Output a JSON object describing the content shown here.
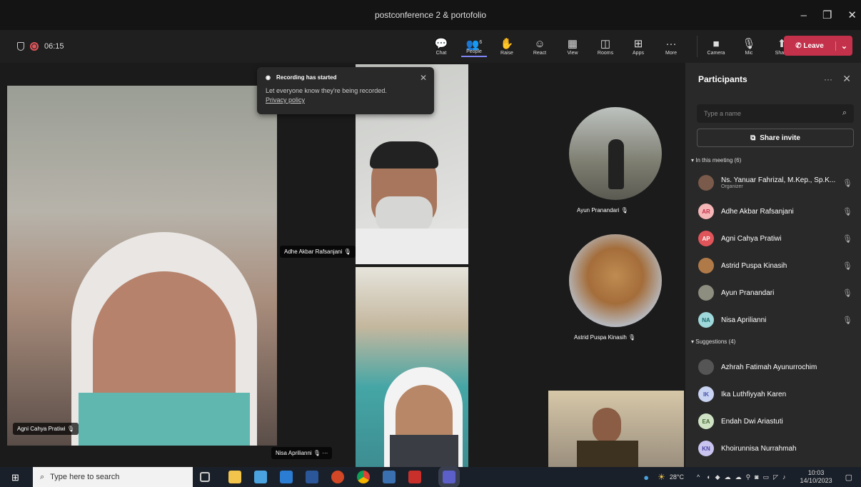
{
  "window": {
    "title": "postconference 2 & portofolio",
    "minimize": "–",
    "maximize": "❐",
    "close": "✕"
  },
  "recording": {
    "timer": "06:15"
  },
  "toolbar": {
    "chat": "Chat",
    "people": "People",
    "people_count": "6",
    "raise": "Raise",
    "react": "React",
    "view": "View",
    "rooms": "Rooms",
    "apps": "Apps",
    "more": "More",
    "camera": "Camera",
    "mic": "Mic",
    "share": "Share",
    "leave": "Leave"
  },
  "toast": {
    "title": "Recording has started",
    "body": "Let everyone know they're being recorded.",
    "link": "Privacy policy"
  },
  "video": {
    "agni": "Agni Cahya Pratiwi",
    "adhe": "Adhe Akbar Rafsanjani",
    "nisa": "Nisa Aprilianni",
    "ayun": "Ayun Pranandari",
    "astrid": "Astrid Puspa Kinasih"
  },
  "panel": {
    "title": "Participants",
    "search_placeholder": "Type a name",
    "share_invite": "Share invite",
    "in_meeting": "In this meeting (6)",
    "suggestions": "Suggestions (4)",
    "participants": [
      {
        "name": "Ns. Yanuar Fahrizal, M.Kep., Sp.K...",
        "role": "Organizer",
        "initials": ""
      },
      {
        "name": "Adhe Akbar Rafsanjani",
        "initials": "AR"
      },
      {
        "name": "Agni Cahya Pratiwi",
        "initials": "AP"
      },
      {
        "name": "Astrid Puspa Kinasih",
        "initials": ""
      },
      {
        "name": "Ayun Pranandari",
        "initials": ""
      },
      {
        "name": "Nisa Aprilianni",
        "initials": "NA"
      }
    ],
    "suggested": [
      {
        "name": "Azhrah Fatimah Ayunurrochim",
        "initials": ""
      },
      {
        "name": "Ika Luthfiyyah Karen",
        "initials": "IK"
      },
      {
        "name": "Endah Dwi Ariastuti",
        "initials": "EA"
      },
      {
        "name": "Khoirunnisa Nurrahmah",
        "initials": "KN"
      }
    ]
  },
  "taskbar": {
    "search_placeholder": "Type here to search",
    "temperature": "28°C",
    "time": "10:03",
    "date": "14/10/2023"
  },
  "colors": {
    "accent": "#7f85f5",
    "leave": "#c4314b",
    "recording": "#e0555a"
  }
}
